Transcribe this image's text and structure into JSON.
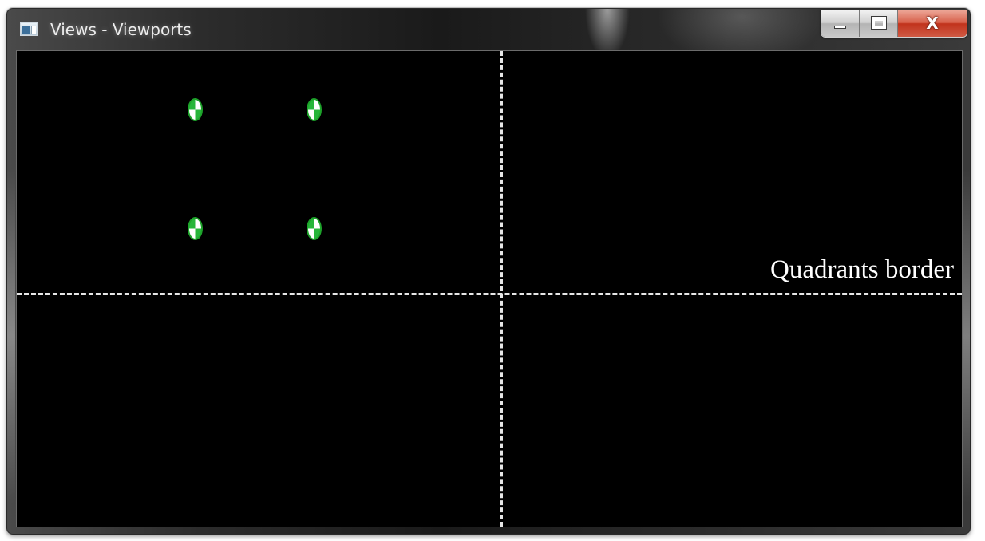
{
  "window": {
    "title": "Views - Viewports",
    "icon": "window-app-icon",
    "buttons": {
      "minimize": "minimize-icon",
      "maximize": "maximize-icon",
      "close": "close-icon",
      "close_label": "X"
    }
  },
  "viewport": {
    "background": "#000000",
    "quadrant_label": "Quadrants border",
    "line_color": "#e6e6e6",
    "marker_colors": [
      "#27b53a",
      "#ffffff"
    ],
    "marker_count": 4
  }
}
